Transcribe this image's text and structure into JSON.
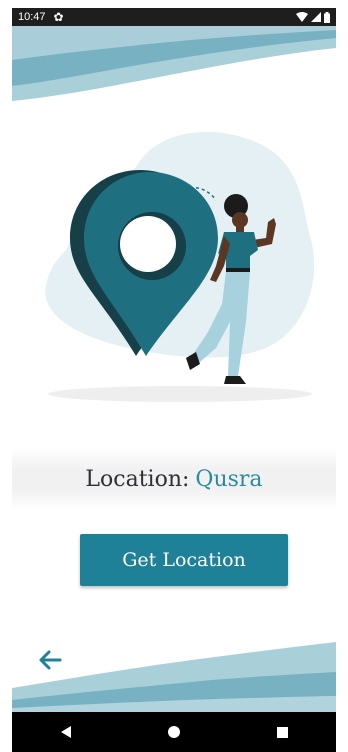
{
  "status_bar": {
    "time": "10:47",
    "icons": [
      "settings-gear-icon",
      "wifi-icon",
      "signal-icon",
      "battery-icon"
    ]
  },
  "main": {
    "location_label": "Location:",
    "location_value": "Qusra",
    "get_location_button": "Get Location"
  },
  "navigation": {
    "back_icon": "arrow-left-icon",
    "system_nav": [
      "back-triangle-icon",
      "home-circle-icon",
      "recents-square-icon"
    ]
  },
  "colors": {
    "accent": "#1f8197",
    "location_value": "#2a8aa0",
    "label_text": "#2f2f37",
    "wave_light": "#a9cfd9",
    "wave_mid": "#78b1c2",
    "pin": "#1e6f80"
  }
}
